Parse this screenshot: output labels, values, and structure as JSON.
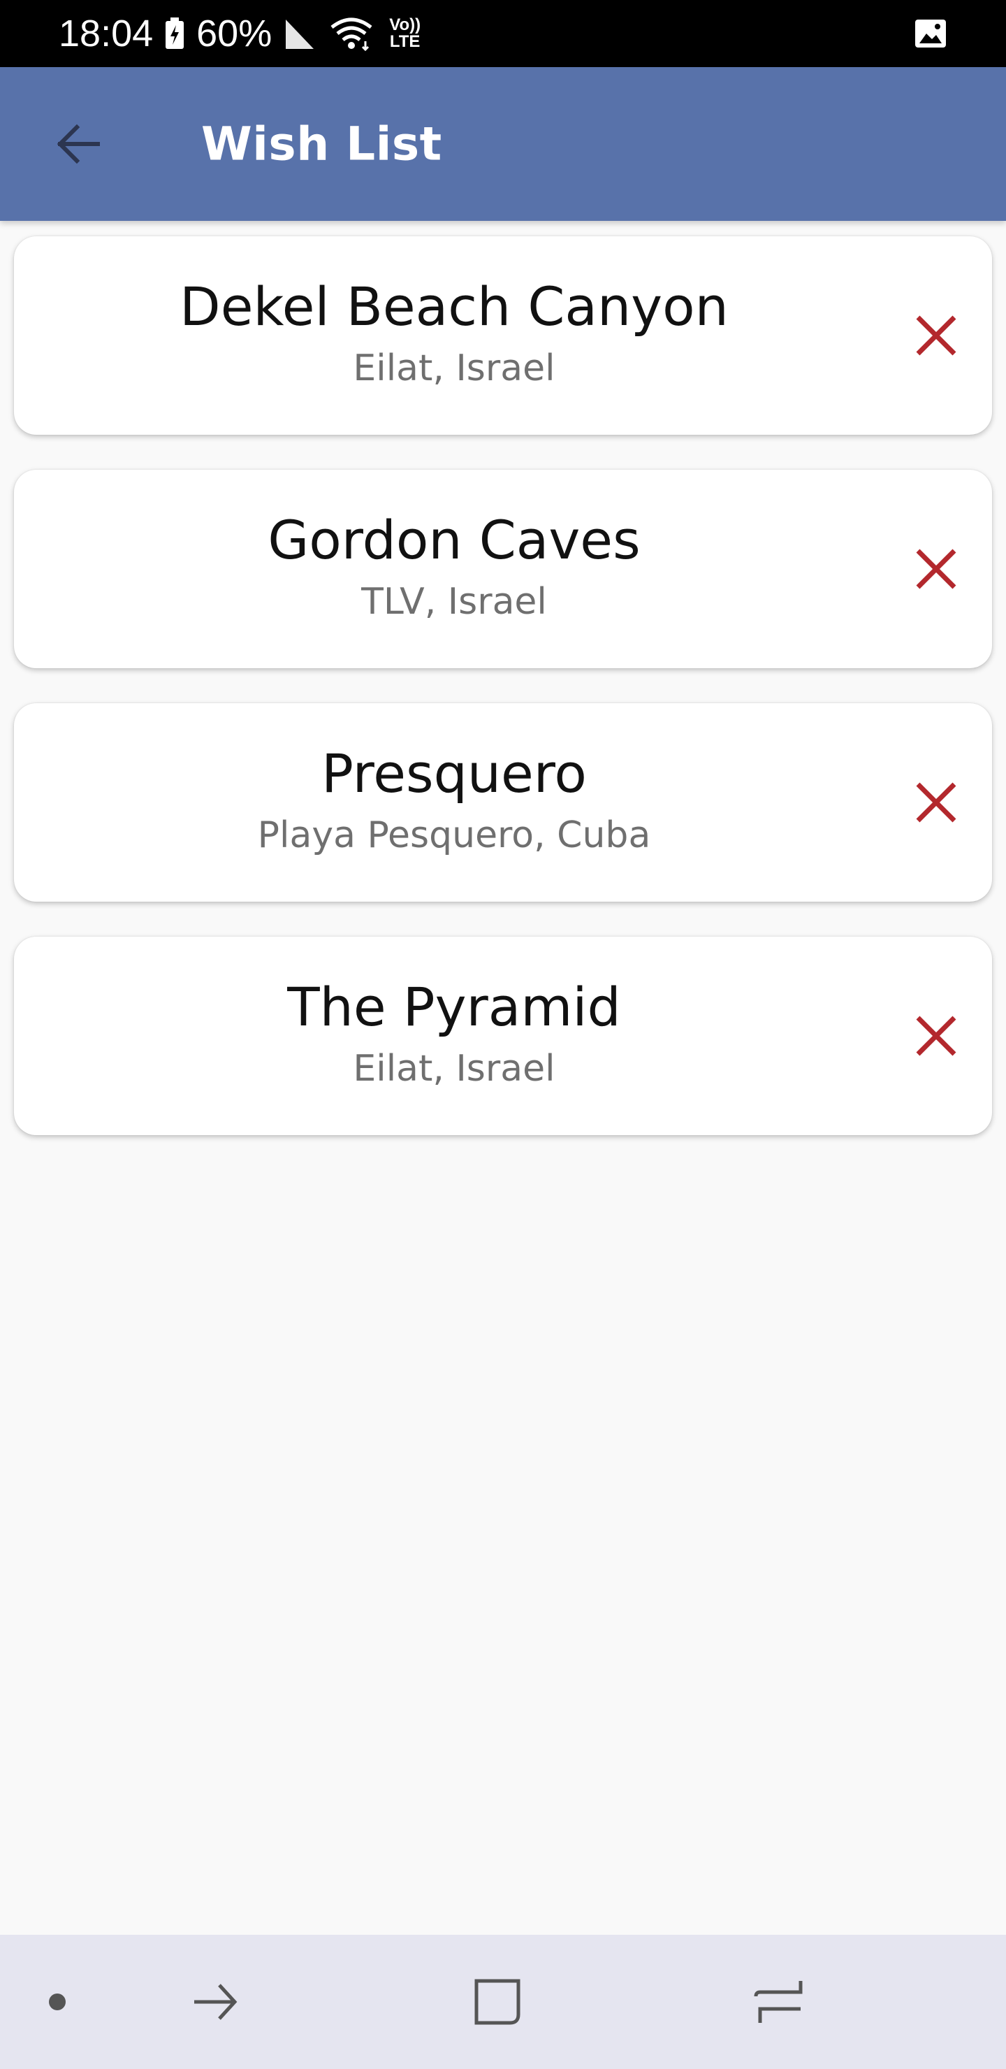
{
  "status_bar": {
    "time": "18:04",
    "battery": "60%",
    "icons": [
      "battery-charging-icon",
      "signal-icon",
      "wifi-icon",
      "volte-icon",
      "gallery-icon"
    ],
    "volte_top": "Vo))",
    "volte_bottom": "LTE"
  },
  "app_bar": {
    "title": "Wish List",
    "background_color": "#5872aa",
    "back_icon": "arrow-back-icon"
  },
  "wishlist": [
    {
      "name": "Dekel Beach Canyon",
      "location": "Eilat, Israel"
    },
    {
      "name": "Gordon Caves",
      "location": "TLV, Israel"
    },
    {
      "name": "Presquero",
      "location": "Playa Pesquero, Cuba"
    },
    {
      "name": "The Pyramid",
      "location": "Eilat, Israel"
    }
  ],
  "remove_icon_color": "#b3282d",
  "nav_bar": {
    "icons": [
      "dot-icon",
      "back-nav-icon",
      "home-icon",
      "recents-icon"
    ]
  }
}
